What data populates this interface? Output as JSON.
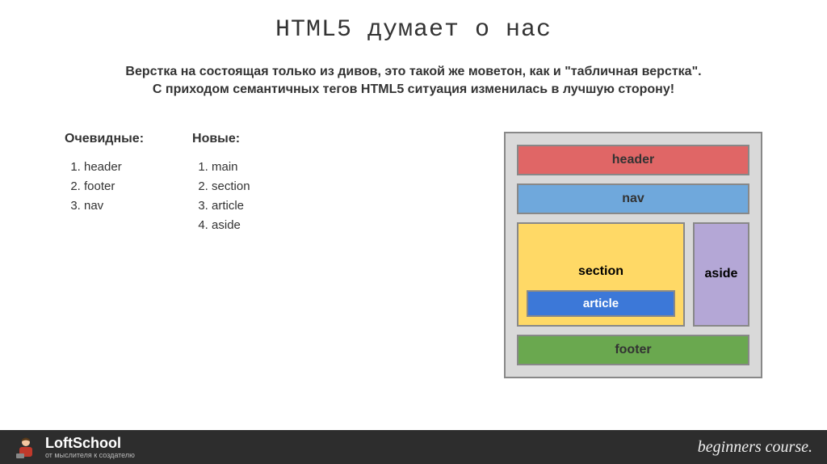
{
  "title": "HTML5 думает о нас",
  "subtitle_line1": "Верстка на состоящая только из дивов, это такой же моветон, как и \"табличная верстка\".",
  "subtitle_line2": "С приходом семантичных тегов HTML5 ситуация изменилась в лучшую сторону!",
  "obvious": {
    "title": "Очевидные:",
    "items": [
      "header",
      "footer",
      "nav"
    ]
  },
  "new": {
    "title": "Новые:",
    "items": [
      "main",
      "section",
      "article",
      "aside"
    ]
  },
  "diagram": {
    "header": "header",
    "nav": "nav",
    "section": "section",
    "article": "article",
    "aside": "aside",
    "footer": "footer"
  },
  "footer": {
    "brand": "LoftSchool",
    "tagline": "от мыслителя к создателю",
    "course": "beginners course."
  }
}
